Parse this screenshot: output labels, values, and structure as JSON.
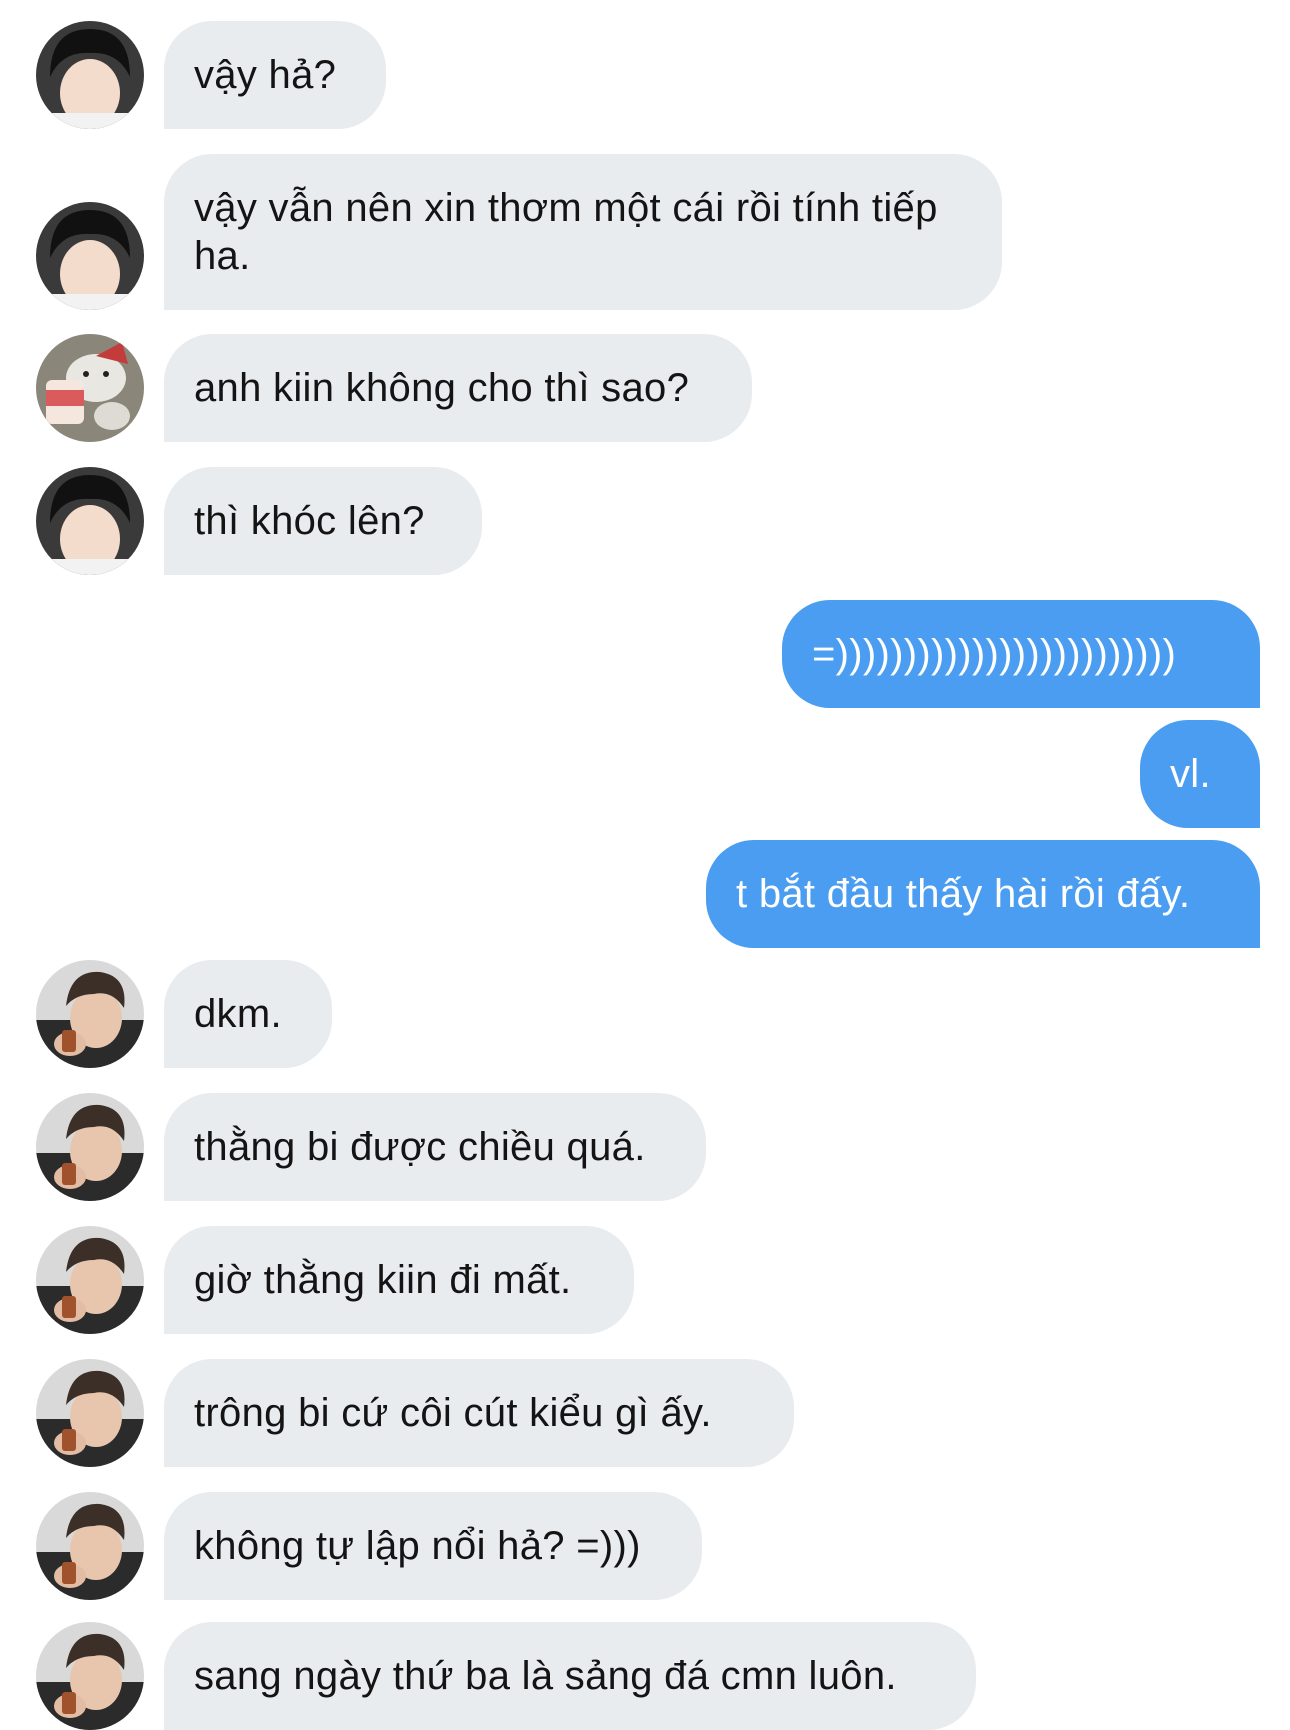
{
  "conversation": {
    "messages": [
      {
        "sender": "boy-a",
        "direction": "incoming",
        "text": "vậy hả?"
      },
      {
        "sender": "boy-a",
        "direction": "incoming",
        "text": "vậy vẫn nên xin thơm một cái rồi tính tiếp ha."
      },
      {
        "sender": "bear",
        "direction": "incoming",
        "text": "anh kiin không cho thì sao?"
      },
      {
        "sender": "boy-a",
        "direction": "incoming",
        "text": "thì khóc lên?"
      },
      {
        "sender": "me",
        "direction": "outgoing",
        "text": "=)))))))))))))))))))))))))"
      },
      {
        "sender": "me",
        "direction": "outgoing",
        "text": "vl."
      },
      {
        "sender": "me",
        "direction": "outgoing",
        "text": "t bắt đầu thấy hài rồi đấy."
      },
      {
        "sender": "boy-b",
        "direction": "incoming",
        "text": "dkm."
      },
      {
        "sender": "boy-b",
        "direction": "incoming",
        "text": "thằng bi được chiều quá."
      },
      {
        "sender": "boy-b",
        "direction": "incoming",
        "text": "giờ thằng kiin đi mất."
      },
      {
        "sender": "boy-b",
        "direction": "incoming",
        "text": "trông bi cứ côi cút kiểu gì ấy."
      },
      {
        "sender": "boy-b",
        "direction": "incoming",
        "text": "không tự lập nổi hả? =)))"
      },
      {
        "sender": "boy-b",
        "direction": "incoming",
        "text": "sang ngày thứ ba là sảng đá cmn luôn."
      }
    ]
  },
  "theme": {
    "incoming_bubble": "#e9ecef",
    "outgoing_bubble": "#4a9df0",
    "incoming_text": "#141414",
    "outgoing_text": "#ffffff"
  }
}
